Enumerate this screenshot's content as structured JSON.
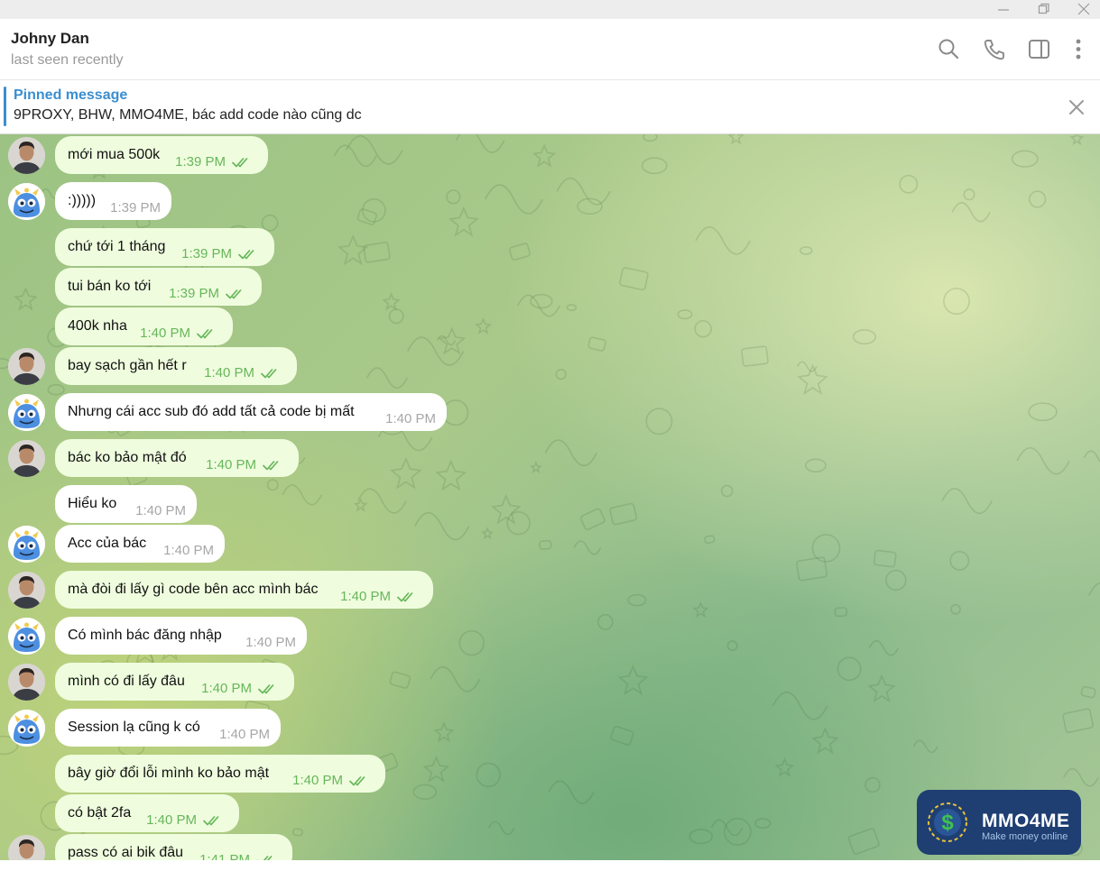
{
  "header": {
    "name": "Johny Dan",
    "status": "last seen recently"
  },
  "pinned": {
    "title": "Pinned message",
    "text": "9PROXY, BHW, MMO4ME, bác add code nào cũng dc"
  },
  "messages": [
    {
      "dir": "out",
      "text": "mới mua 500k",
      "time": "1:39 PM"
    },
    {
      "dir": "in",
      "text": ":)))))",
      "time": "1:39 PM"
    },
    {
      "dir": "out",
      "text": "chứ tới 1 tháng",
      "time": "1:39 PM"
    },
    {
      "dir": "out",
      "text": "tui bán ko tới",
      "time": "1:39 PM"
    },
    {
      "dir": "out",
      "text": "400k nha",
      "time": "1:40 PM"
    },
    {
      "dir": "out",
      "text": "bay sạch gần hết r",
      "time": "1:40 PM"
    },
    {
      "dir": "in",
      "text": "Nhưng cái acc sub đó add tất cả code bị mất",
      "time": "1:40 PM"
    },
    {
      "dir": "out",
      "text": "bác ko bảo mật đó",
      "time": "1:40 PM"
    },
    {
      "dir": "in",
      "text": "Hiểu ko",
      "time": "1:40 PM"
    },
    {
      "dir": "in",
      "text": "Acc của bác",
      "time": "1:40 PM"
    },
    {
      "dir": "out",
      "text": "mà đòi đi lấy gì code bên acc mình bác",
      "time": "1:40 PM"
    },
    {
      "dir": "in",
      "text": "Có mình bác đăng nhập",
      "time": "1:40 PM"
    },
    {
      "dir": "out",
      "text": "mình có đi lấy đâu",
      "time": "1:40 PM"
    },
    {
      "dir": "in",
      "text": "Session lạ cũng k có",
      "time": "1:40 PM"
    },
    {
      "dir": "out",
      "text": "bây giờ đổi lỗi mình ko bảo mật",
      "time": "1:40 PM"
    },
    {
      "dir": "out",
      "text": "có bật 2fa",
      "time": "1:40 PM"
    },
    {
      "dir": "out",
      "text": "pass có ai bik đâu",
      "time": "1:41 PM"
    }
  ],
  "watermark": {
    "brand": "MMO4ME",
    "tagline": "Make money online"
  },
  "icons": [
    "minimize-icon",
    "restore-icon",
    "window-close-icon",
    "search-icon",
    "phone-icon",
    "sidebar-icon",
    "more-vertical-icon",
    "close-icon",
    "double-check-icon"
  ],
  "colors": {
    "accent": "#3a8ed0",
    "outgoing_bubble": "#effdde",
    "incoming_bubble": "#ffffff",
    "outgoing_time": "#67b65b",
    "watermark_bg": "#1f3f72"
  }
}
